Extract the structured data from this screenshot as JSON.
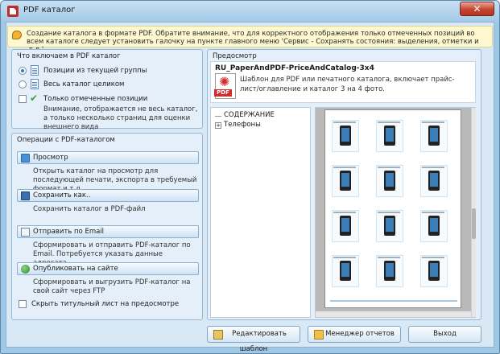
{
  "window": {
    "title": "PDF каталог",
    "close_symbol": "✕"
  },
  "info": {
    "icon": "speech-bubble-icon",
    "text": "Создание каталога в формате PDF. Обратите внимание, что для корректного отображения только отмеченных позиций во всем каталоге следует установить галочку на пункте главного меню 'Сервис - Сохранять состояния: выделения, отметки и .т.д.'"
  },
  "include_group": {
    "title": "Что включаем в PDF каталог",
    "options": [
      {
        "label": "Позиции из текущей группы",
        "selected": true,
        "icon": "document-icon"
      },
      {
        "label": "Весь каталог целиком",
        "selected": false,
        "icon": "document-icon"
      }
    ],
    "checked_only": {
      "label": "Только отмеченные позиции",
      "checked": false,
      "icon": "check-icon",
      "description": "Внимание, отображается не весь каталог, а только несколько страниц для оценки внешнего вида"
    }
  },
  "operations_group": {
    "title": "Операции с PDF-каталогом",
    "operations": [
      {
        "label": "Просмотр",
        "icon": "preview-icon",
        "description": "Открыть каталог на просмотр для последующей печати, экспорта в требуемый формат и т.д."
      },
      {
        "label": "Сохранить как..",
        "icon": "save-icon",
        "description": "Сохранить каталог в PDF-файл"
      },
      {
        "label": "Отправить по Email",
        "icon": "email-icon",
        "description": "Сформировать и отправить PDF-каталог по Email. Потребуется указать данные адресата."
      },
      {
        "label": "Опубликовать на сайте",
        "icon": "globe-icon",
        "description": "Сформировать и выгрузить PDF-каталог на свой сайт через FTP"
      }
    ],
    "hide_title_page": {
      "label": "Скрыть титульный лист на предосмотре",
      "checked": false
    }
  },
  "preview": {
    "title": "Предосмотр",
    "template_name": "RU_PaperAndPDF-PriceAndCatalog-3x4",
    "template_description": "Шаблон для PDF или печатного каталога, включает прайс-лист/оглавление и каталог 3 на 4 фото.",
    "pdf_icon_label": "PDF",
    "tree": [
      {
        "label": "СОДЕРЖАНИЕ",
        "expandable": false
      },
      {
        "label": "Телефоны",
        "expandable": true,
        "expander_symbol": "+"
      }
    ]
  },
  "buttons": {
    "edit_template": {
      "label": "Редактировать шаблон",
      "icon": "edit-template-icon"
    },
    "report_manager": {
      "label": "Менеджер отчетов",
      "icon": "folder-icon"
    },
    "exit": {
      "label": "Выход"
    }
  }
}
